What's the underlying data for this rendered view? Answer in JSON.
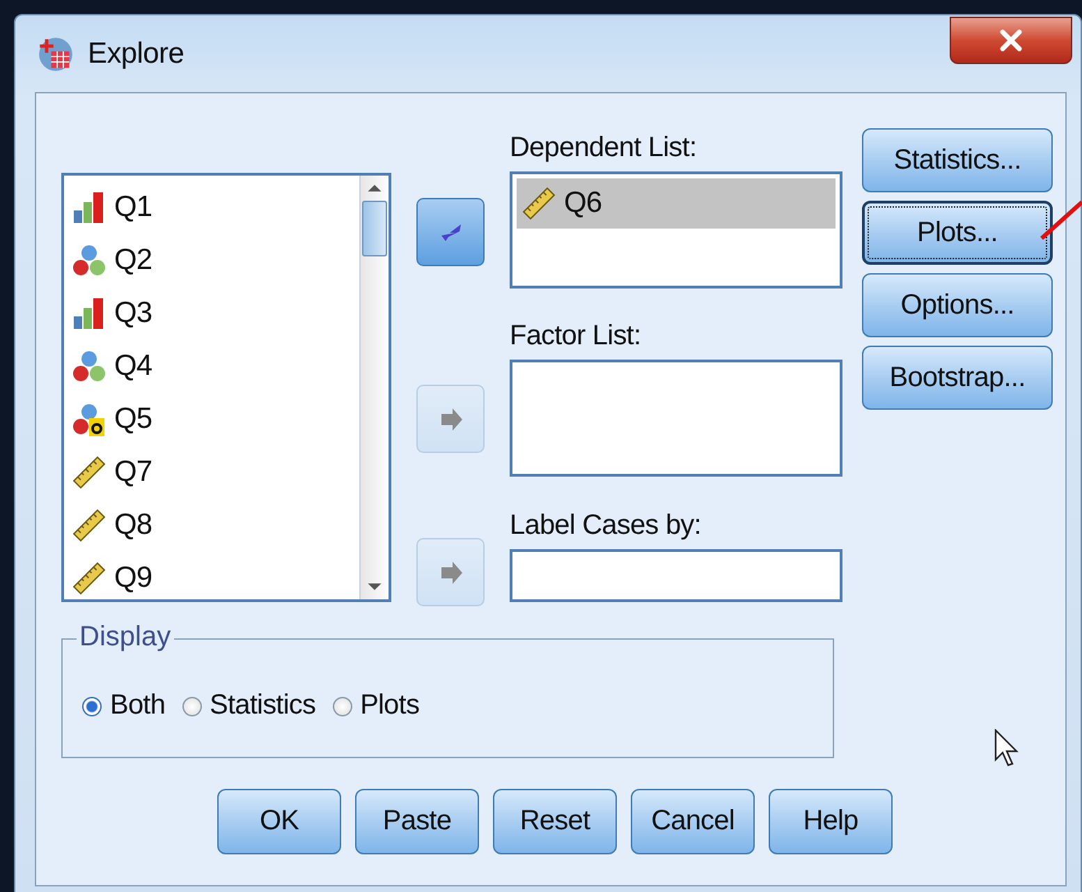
{
  "window": {
    "title": "Explore"
  },
  "source_variables": [
    {
      "name": "Q1",
      "kind": "ordinal"
    },
    {
      "name": "Q2",
      "kind": "nominal"
    },
    {
      "name": "Q3",
      "kind": "ordinal"
    },
    {
      "name": "Q4",
      "kind": "nominal"
    },
    {
      "name": "Q5",
      "kind": "nominal-string"
    },
    {
      "name": "Q7",
      "kind": "scale"
    },
    {
      "name": "Q8",
      "kind": "scale"
    },
    {
      "name": "Q9",
      "kind": "scale"
    }
  ],
  "move_buttons": [
    {
      "kind": "left",
      "disabled": false
    },
    {
      "kind": "right",
      "disabled": true
    },
    {
      "kind": "right",
      "disabled": true
    }
  ],
  "dependent_list": {
    "label": "Dependent List:",
    "items": [
      {
        "name": "Q6",
        "kind": "scale",
        "selected": true
      }
    ]
  },
  "factor_list": {
    "label": "Factor List:"
  },
  "label_cases": {
    "label": "Label Cases by:"
  },
  "side_buttons": [
    {
      "label": "Statistics...",
      "focused": false
    },
    {
      "label": "Plots...",
      "focused": true
    },
    {
      "label": "Options...",
      "focused": false
    },
    {
      "label": "Bootstrap...",
      "focused": false
    }
  ],
  "display": {
    "title": "Display",
    "options": [
      {
        "label": "Both",
        "selected": true
      },
      {
        "label": "Statistics",
        "selected": false
      },
      {
        "label": "Plots",
        "selected": false
      }
    ]
  },
  "buttons": [
    "OK",
    "Paste",
    "Reset",
    "Cancel",
    "Help"
  ]
}
